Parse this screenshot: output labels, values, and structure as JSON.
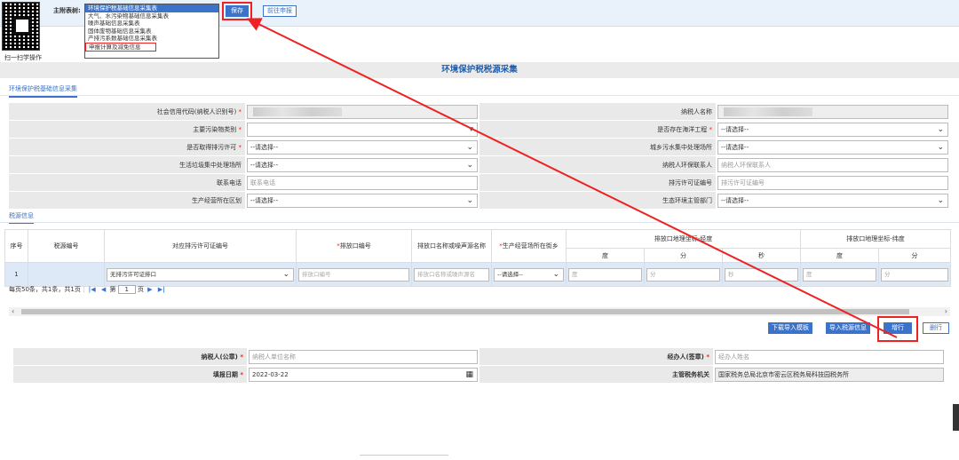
{
  "header": {
    "qr_caption": "扫一扫学操作",
    "main_table_label": "主附表树:",
    "dropdown_items": [
      "环境保护税基础信息采集表",
      "大气、水污染物基础信息采集表",
      "噪声基础信息采集表",
      "固体废物基础信息采集表",
      "产排污系数基础信息采集表",
      "申报计算及减免信息"
    ],
    "save_label": "保存",
    "apply_label": "前往申报"
  },
  "page_title": "环境保护税税源采集",
  "tab_basic": "环境保护税基础信息采集",
  "form": {
    "rows": [
      {
        "l1": "社会信用代码(纳税人识别号)",
        "r1": true,
        "v1": "",
        "l2": "纳税人名称",
        "r2": false,
        "v2": ""
      },
      {
        "l1": "主要污染物类别",
        "r1": true,
        "v1": "",
        "l2": "是否存在海洋工程",
        "r2": true,
        "v2": "--请选择--"
      },
      {
        "l1": "是否取得排污许可",
        "r1": true,
        "v1": "--请选择--",
        "l2": "城乡污水集中处理场所",
        "r2": false,
        "v2": "--请选择--"
      },
      {
        "l1": "生活垃圾集中处理场所",
        "r1": false,
        "v1": "--请选择--",
        "l2": "纳税人环保联系人",
        "r2": false,
        "v2": "纳税人环保联系人"
      },
      {
        "l1": "联系电话",
        "r1": false,
        "v1": "联系电话",
        "l2": "排污许可证编号",
        "r2": false,
        "v2": "排污许可证编号"
      },
      {
        "l1": "生产经营所在区划",
        "r1": false,
        "v1": "--请选择--",
        "l2": "生态环境主管部门",
        "r2": false,
        "v2": "--请选择--"
      }
    ]
  },
  "tab_source": "税源信息",
  "grid": {
    "headers": {
      "seq": "序号",
      "tax_source_no": "税源编号",
      "permit_no": "对应排污许可证编号",
      "outlet_no": "排放口编号",
      "outlet_name": "排放口名称或噪声源名称",
      "street": "生产经营场所在街乡",
      "lon_group": "排放口地理坐标-经度",
      "lat_group": "排放口地理坐标-纬度",
      "deg": "度",
      "min": "分",
      "sec": "秒"
    },
    "row": {
      "seq": "1",
      "permit_value": "无排污许可证排口",
      "outlet_ph": "排放口编号",
      "outlet_name_ph": "排放口名称或噪声源名",
      "street_value": "--请选择--",
      "deg_ph": "度",
      "min_ph": "分",
      "sec_ph": "秒"
    }
  },
  "pager": {
    "summary": "每页50条，共1条，共1页",
    "page_prefix": "第",
    "page_value": "1",
    "page_suffix": "页"
  },
  "actions": {
    "download_template": "下载导入模板",
    "import_tax_source": "导入税源信息",
    "add_row": "增行",
    "delete_row": "删行"
  },
  "bottom": {
    "taxpayer_seal_label": "纳税人(公章)",
    "taxpayer_seal_ph": "纳税人单位名称",
    "handler_label": "经办人(签章)",
    "handler_ph": "经办人姓名",
    "fill_date_label": "填报日期",
    "fill_date_value": "2022-03-22",
    "tax_authority_label": "主管税务机关",
    "tax_authority_value": "国家税务总局北京市密云区税务局科技园税务所"
  },
  "colors": {
    "accent": "#3a73c9",
    "annotation": "#e22222",
    "title": "#1d5fb0"
  }
}
